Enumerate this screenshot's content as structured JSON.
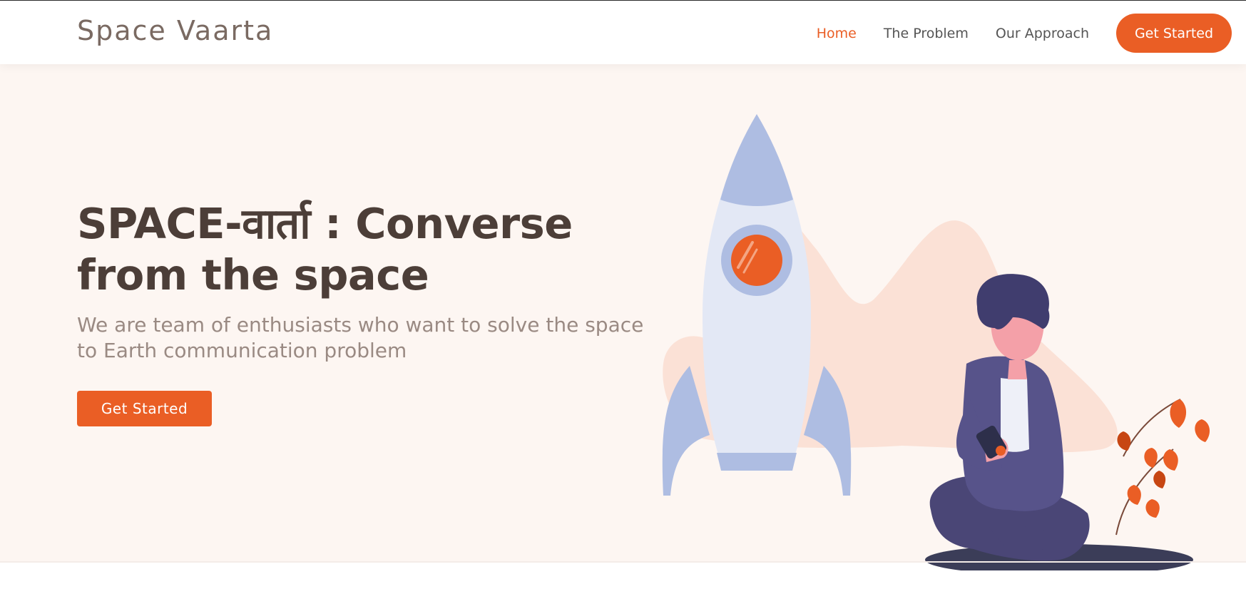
{
  "header": {
    "logo": "Space Vaarta",
    "nav": {
      "home": "Home",
      "problem": "The Problem",
      "approach": "Our Approach",
      "cta": "Get Started"
    }
  },
  "hero": {
    "title": "SPACE-वार्ता : Converse from the space",
    "subtitle": "We are team of enthusiasts who want to solve the space to Earth communication problem",
    "cta": "Get Started"
  },
  "colors": {
    "accent": "#ea5e25",
    "hero_background": "#fdf6f2",
    "title_text": "#4c3e38",
    "subtitle_text": "#9a8a83"
  },
  "icons": {
    "illustration": "rocket-and-person-illustration"
  }
}
